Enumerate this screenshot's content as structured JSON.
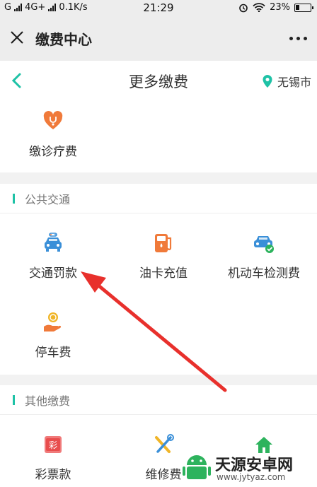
{
  "status_bar": {
    "carrier1": "G",
    "carrier2": "4G+",
    "speed": "0.1K/s",
    "time": "21:29",
    "battery": "23%"
  },
  "nav": {
    "title": "缴费中心",
    "close_icon": "close-icon",
    "more_icon": "more-icon"
  },
  "header": {
    "title": "更多缴费",
    "location": "无锡市",
    "location_icon": "location-pin-icon"
  },
  "medical": {
    "items": [
      {
        "label": "缴诊疗费",
        "icon": "heart-stethoscope-icon"
      }
    ]
  },
  "sections": [
    {
      "title": "公共交通",
      "items": [
        {
          "label": "交通罚款",
          "icon": "traffic-car-icon"
        },
        {
          "label": "油卡充值",
          "icon": "fuel-pump-icon"
        },
        {
          "label": "机动车检测费",
          "icon": "car-inspection-icon"
        },
        {
          "label": "停车费",
          "icon": "parking-coin-icon"
        }
      ]
    },
    {
      "title": "其他缴费",
      "items": [
        {
          "label": "彩票款",
          "icon": "lottery-icon"
        },
        {
          "label": "维修费",
          "icon": "tools-icon"
        },
        {
          "label": "",
          "icon": "house-icon"
        }
      ]
    }
  ],
  "lottery_glyph": "彩",
  "watermark": {
    "title": "天源安卓网",
    "url": "www.jytyaz.com"
  },
  "colors": {
    "accent": "#1ec2a6",
    "icon_orange": "#f07a3a",
    "icon_blue": "#3a8fd8",
    "icon_yellow": "#f0b528",
    "arrow_red": "#e8302c"
  }
}
